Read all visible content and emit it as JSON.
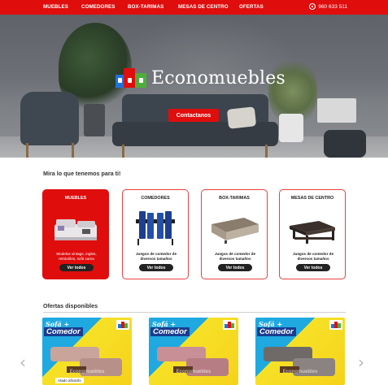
{
  "nav": {
    "items": [
      {
        "label": "MUEBLES"
      },
      {
        "label": "COMEDORES"
      },
      {
        "label": "BOX-TARIMAS"
      },
      {
        "label": "MESAS DE CENTRO"
      },
      {
        "label": "OFERTAS"
      }
    ],
    "phone": "960 633 511",
    "phone_icon": "whatsapp-icon"
  },
  "hero": {
    "brand": "Economuebles",
    "cta": "Contactanos",
    "slides": 2,
    "active_slide": 1
  },
  "categories": {
    "title": "Mira lo que tenemos para ti!",
    "items": [
      {
        "title": "MUEBLES",
        "desc": "Modelos vintage, ingles, retráctiles, sofá cama",
        "button": "Ver todos",
        "active": true
      },
      {
        "title": "COMEDORES",
        "desc": "Juegos de comedor de diversos tamaños",
        "button": "Ver todos",
        "active": false
      },
      {
        "title": "BOX-TARIMAS",
        "desc": "Juegos de comedor de diversos tamaños",
        "button": "Ver todos",
        "active": false
      },
      {
        "title": "MESAS DE CENTRO",
        "desc": "Juegos de comedor de diversos tamaños",
        "button": "Ver todos",
        "active": false
      }
    ]
  },
  "offers": {
    "title": "Ofertas disponibles",
    "items": [
      {
        "script": "Sofá +",
        "main": "Comedor",
        "badge": "Atado aficanfo",
        "watermark": "Economuebles"
      },
      {
        "script": "Sofá +",
        "main": "Comedor",
        "badge": "",
        "watermark": "Economuebles"
      },
      {
        "script": "Sofá +",
        "main": "Comedor",
        "badge": "",
        "watermark": "Economuebles"
      }
    ],
    "prev_icon": "‹",
    "next_icon": "›"
  },
  "colors": {
    "brand_red": "#e00d0d",
    "dark_button": "#222222"
  }
}
